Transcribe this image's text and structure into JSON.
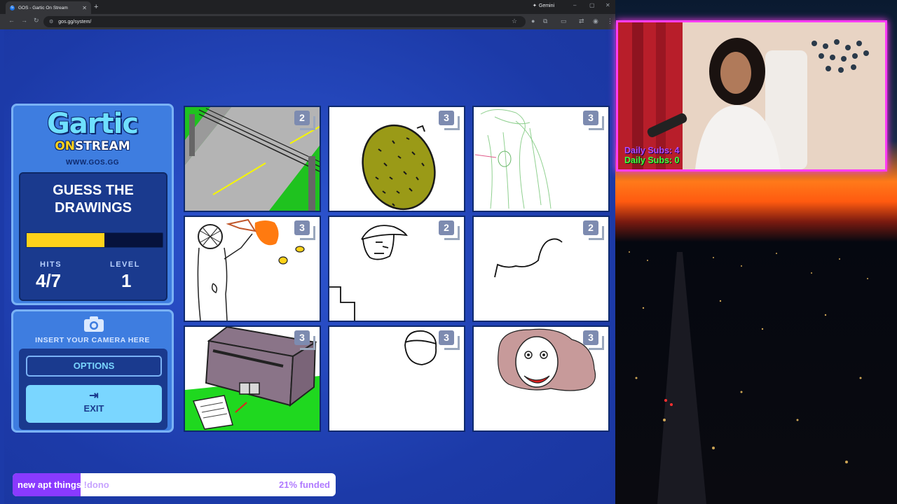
{
  "browser": {
    "tab_title": "GOS - Gartic On Stream",
    "new_tab_icon": "plus-icon",
    "gemini_label": "Gemini",
    "url": "gos.gg/system/"
  },
  "game": {
    "logo_main": "Gartic",
    "logo_on": "ON",
    "logo_stream": "STREAM",
    "website": "WWW.GOS.GG",
    "guess_title": "GUESS THE DRAWINGS",
    "progress_fraction": 0.57,
    "hits_label": "HITS",
    "hits_value": "4/7",
    "level_label": "LEVEL",
    "level_value": "1",
    "camera_text": "INSERT YOUR CAMERA HERE",
    "options_label": "OPTIONS",
    "exit_label": "EXIT",
    "cards": [
      {
        "count": "2",
        "subject": "road-drawing"
      },
      {
        "count": "3",
        "subject": "durian-drawing"
      },
      {
        "count": "3",
        "subject": "green-sketch-drawing"
      },
      {
        "count": "3",
        "subject": "beekeeper-drawing"
      },
      {
        "count": "2",
        "subject": "face-with-cap-drawing"
      },
      {
        "count": "2",
        "subject": "squiggle-drawing"
      },
      {
        "count": "3",
        "subject": "building-drawing"
      },
      {
        "count": "3",
        "subject": "head-drawing"
      },
      {
        "count": "3",
        "subject": "curly-hair-face-drawing"
      }
    ]
  },
  "goal": {
    "text_highlight": "new apt things",
    "text_rest": " !dono",
    "percent_text": "21% funded",
    "fraction": 0.21
  },
  "overlay": {
    "daily_subs_a": "Daily Subs: 4",
    "daily_subs_b": "Daily Subs: 0"
  },
  "colors": {
    "page_blue": "#1c3aa8",
    "panel_blue": "#3e7de0",
    "progress_yellow": "#ffd21a",
    "goal_purple": "#8a3aff",
    "facecam_border": "#ff3cf5"
  }
}
